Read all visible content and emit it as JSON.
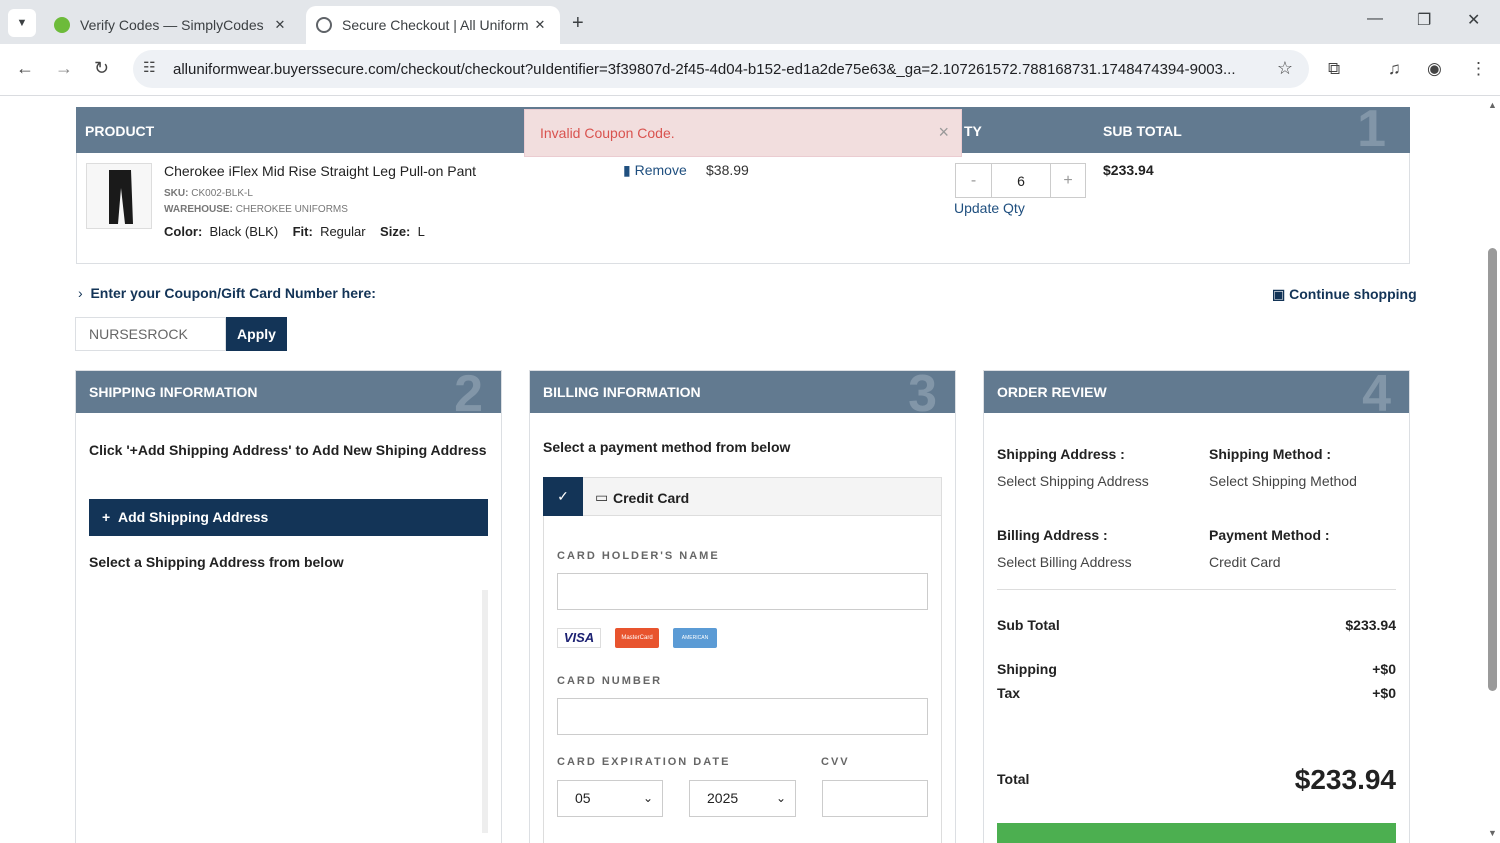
{
  "browser": {
    "tabs": [
      {
        "title": "Verify Codes — SimplyCodes",
        "close": "✕"
      },
      {
        "title": "Secure Checkout | All Uniform W",
        "close": "✕"
      }
    ],
    "new_tab": "+",
    "url": "alluniformwear.buyerssecure.com/checkout/checkout?uIdentifier=3f39807d-2f45-4d04-b152-ed1a2de75e63&_ga=2.107261572.788168731.1748474394-9003..."
  },
  "product_table": {
    "headers": {
      "product": "PRODUCT",
      "qty": "TY",
      "subtotal": "SUB TOTAL"
    },
    "step": "1",
    "item": {
      "name": "Cherokee iFlex Mid Rise Straight Leg Pull-on Pant",
      "sku_label": "SKU:",
      "sku": "CK002-BLK-L",
      "warehouse_label": "WAREHOUSE:",
      "warehouse": "CHEROKEE UNIFORMS",
      "color_label": "Color:",
      "color": "Black (BLK)",
      "fit_label": "Fit:",
      "fit": "Regular",
      "size_label": "Size:",
      "size": "L",
      "remove": "Remove",
      "price": "$38.99",
      "qty_minus": "-",
      "qty": "6",
      "qty_plus": "+",
      "update_qty": "Update Qty",
      "subtotal": "$233.94"
    }
  },
  "alert": {
    "message": "Invalid Coupon Code.",
    "close": "×"
  },
  "coupon": {
    "toggle": "Enter your Coupon/Gift Card Number here:",
    "value": "NURSESROCK",
    "apply": "Apply",
    "continue": "Continue shopping"
  },
  "shipping": {
    "title": "SHIPPING INFORMATION",
    "step": "2",
    "instruction": "Click '+Add Shipping Address' to Add New Shiping Address",
    "add_button": "Add Shipping Address",
    "select_text": "Select a Shipping Address from below"
  },
  "billing": {
    "title": "BILLING INFORMATION",
    "step": "3",
    "instruction": "Select a payment method from below",
    "method": "Credit Card",
    "card_holder_label": "CARD HOLDER'S NAME",
    "card_number_label": "CARD NUMBER",
    "expiry_label": "CARD EXPIRATION DATE",
    "cvv_label": "CVV",
    "month": "05",
    "year": "2025",
    "card_brands": [
      "VISA",
      "MasterCard",
      "AMERICAN EXPRESS"
    ]
  },
  "review": {
    "title": "ORDER REVIEW",
    "step": "4",
    "shipping_address_label": "Shipping Address :",
    "shipping_address": "Select Shipping Address",
    "shipping_method_label": "Shipping Method :",
    "shipping_method": "Select Shipping Method",
    "billing_address_label": "Billing Address :",
    "billing_address": "Select Billing Address",
    "payment_method_label": "Payment Method :",
    "payment_method": "Credit Card",
    "subtotal_label": "Sub Total",
    "subtotal": "$233.94",
    "shipping_label": "Shipping",
    "shipping": "+$0",
    "tax_label": "Tax",
    "tax": "+$0",
    "total_label": "Total",
    "total": "$233.94"
  },
  "colors": {
    "header": "#627a90",
    "navy": "#133457",
    "alert_bg": "#f2dede",
    "alert_text": "#d9534f",
    "green": "#4caf50"
  }
}
